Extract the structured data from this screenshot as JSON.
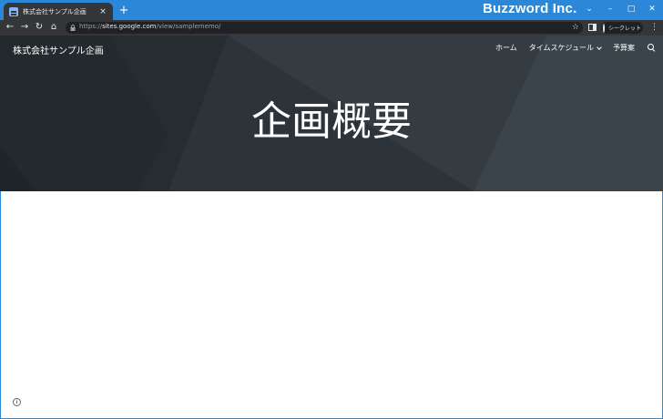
{
  "browser": {
    "tab_title": "株式会社サンプル企画",
    "tab_close": "×",
    "new_tab": "+",
    "brand": "Buzzword Inc.",
    "window_controls": {
      "collapse": "⌄",
      "minimize": "–",
      "maximize": "□",
      "close": "✕"
    },
    "nav": {
      "back": "←",
      "forward": "→",
      "reload": "↻",
      "home": "⌂"
    },
    "url_scheme": "https://",
    "url_host": "sites.google.com",
    "url_path": "/view/samplememo/",
    "star": "☆",
    "incognito_label": "シークレット",
    "menu": "⋮"
  },
  "site": {
    "name": "株式会社サンプル企画",
    "nav": [
      "ホーム",
      "タイムスケジュール",
      "予算案"
    ],
    "title": "企画概要",
    "info": "i"
  },
  "icons": [
    "favicon-icon",
    "close-icon",
    "plus-icon",
    "back-icon",
    "forward-icon",
    "reload-icon",
    "home-icon",
    "lock-icon",
    "star-icon",
    "side-panel-icon",
    "incognito-icon",
    "menu-icon",
    "chevron-down-icon",
    "search-icon",
    "info-icon"
  ],
  "colors": {
    "titlebar": "#2b88d8",
    "toolbar": "#35363a",
    "hero": "#2c3338"
  }
}
